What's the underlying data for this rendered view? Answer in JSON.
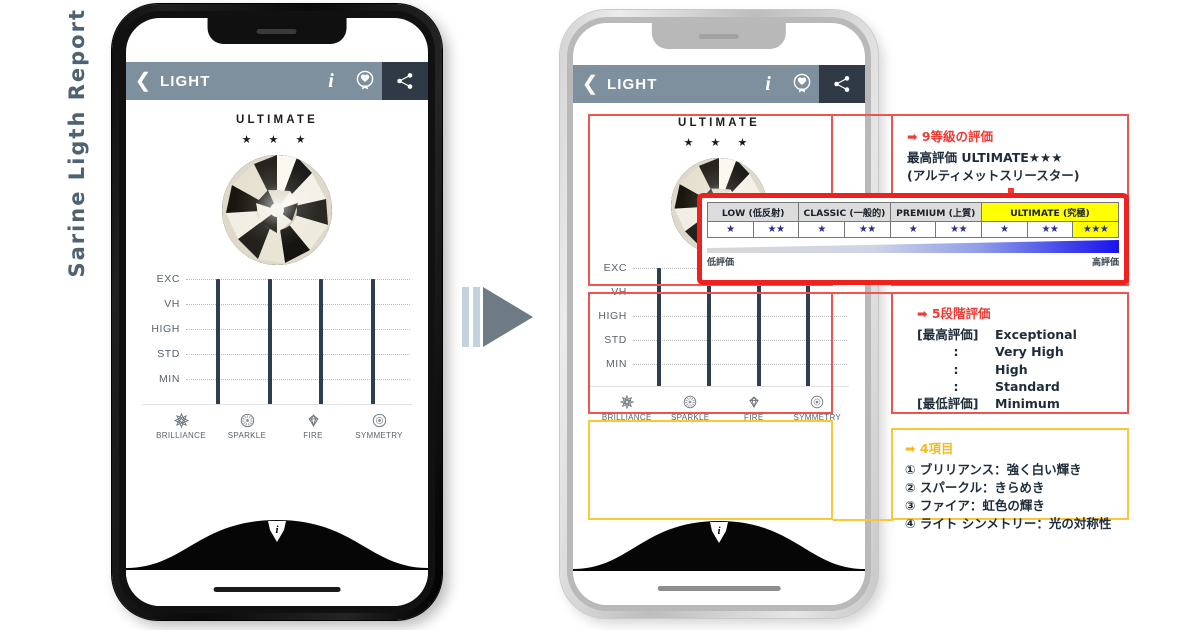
{
  "side_title": "Sarine Ligth Report",
  "app": {
    "header": {
      "back_icon": "chevron-left-icon",
      "title": "LIGHT",
      "info_icon": "i",
      "badge_icon": "medal-icon",
      "share_icon": "share-icon"
    },
    "grade_word": "ULTIMATE",
    "grade_stars": "★ ★ ★",
    "bottom_info_icon": "i"
  },
  "chart_data": {
    "type": "bar",
    "title": "",
    "categories": [
      "BRILLIANCE",
      "SPARKLE",
      "FIRE",
      "SYMMETRY"
    ],
    "values": [
      5,
      5,
      5,
      5
    ],
    "ytick_labels": [
      "EXC",
      "VH",
      "HIGH",
      "STD",
      "MIN"
    ],
    "ylim": [
      0,
      5
    ],
    "grid": true,
    "legend": "none",
    "xlabel": "",
    "ylabel": "",
    "icons": [
      "brilliance-starburst-icon",
      "sparkle-dotted-circle-icon",
      "fire-diamond-icon",
      "symmetry-target-icon"
    ]
  },
  "grading_table": {
    "groups": [
      {
        "label": "LOW (低反射)",
        "highlight": false
      },
      {
        "label": "CLASSIC (一般的)",
        "highlight": false
      },
      {
        "label": "PREMIUM (上質)",
        "highlight": false
      },
      {
        "label": "ULTIMATE (究極)",
        "highlight": true
      }
    ],
    "cells": [
      {
        "stars": "★",
        "highlight": false
      },
      {
        "stars": "★★",
        "highlight": false
      },
      {
        "stars": "★",
        "highlight": false
      },
      {
        "stars": "★★",
        "highlight": false
      },
      {
        "stars": "★",
        "highlight": false
      },
      {
        "stars": "★★",
        "highlight": false
      },
      {
        "stars": "★",
        "highlight": false
      },
      {
        "stars": "★★",
        "highlight": false
      },
      {
        "stars": "★★★",
        "highlight": true
      }
    ],
    "scale_low_label": "低評価",
    "scale_high_label": "高評価"
  },
  "annotations": {
    "grade": {
      "heading": "➡ 9等級の評価",
      "line1": "最高評価 ULTIMATE★★★",
      "line2": "(アルティメットスリースター)",
      "arrow": "down-arrow-icon"
    },
    "levels": {
      "heading": "➡ 5段階評価",
      "rows": [
        {
          "key": "[最高評価]",
          "value": "Exceptional"
        },
        {
          "key": ":",
          "value": "Very High"
        },
        {
          "key": ":",
          "value": "High"
        },
        {
          "key": ":",
          "value": "Standard"
        },
        {
          "key": "[最低評価]",
          "value": "Minimum"
        }
      ]
    },
    "items": {
      "heading": "➡ 4項目",
      "rows": [
        "① ブリリアンス：強く白い輝き",
        "② スパークル：きらめき",
        "③ ファイア：虹色の輝き",
        "④ ライト シンメトリー：光の対称性"
      ]
    }
  },
  "flow_arrow_icon": "play-arrow-icon",
  "colors": {
    "appbar": "#7e909d",
    "share_cell": "#2f3a46",
    "bar": "#2c3e50",
    "red": "#ef5350",
    "red_strong": "#ef3b33",
    "yellow": "#fbc736",
    "highlight": "#ffff00",
    "title": "#4e6272"
  }
}
